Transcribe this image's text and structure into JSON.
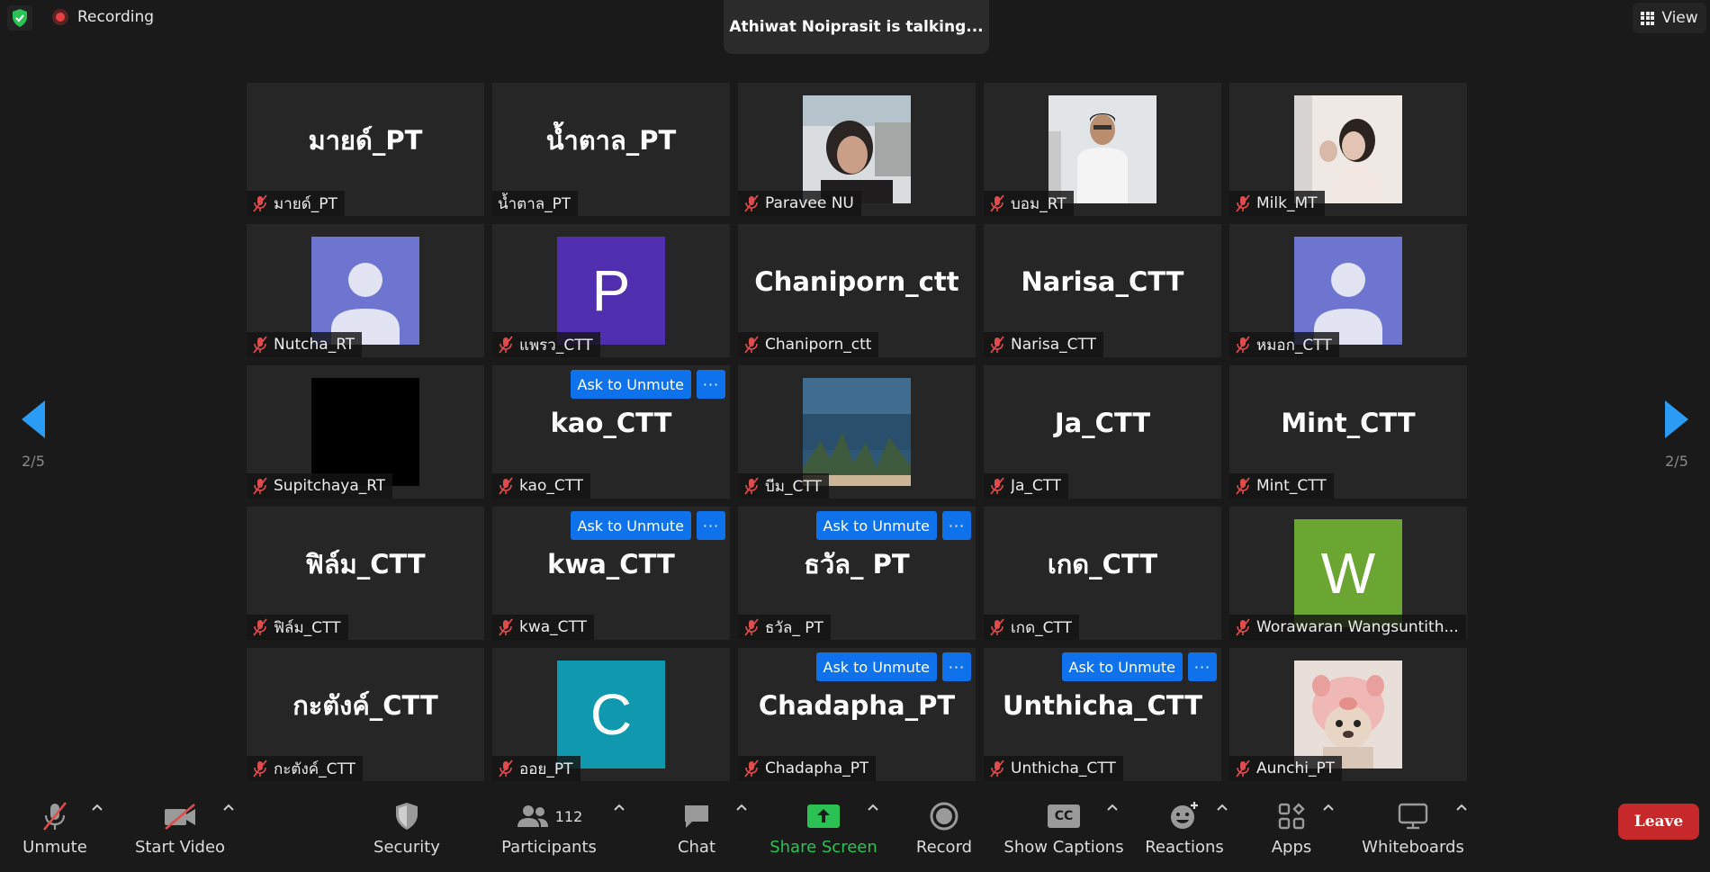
{
  "top": {
    "recording_label": "Recording",
    "talking_label": "Athiwat Noiprasit is talking...",
    "view_label": "View"
  },
  "pagination": {
    "left_label": "2/5",
    "right_label": "2/5"
  },
  "ask_label": "Ask to Unmute",
  "more_label": "···",
  "tiles": [
    {
      "name": "มายด์_PT",
      "big": "มายด์_PT",
      "muted": true
    },
    {
      "name": "น้ำตาล_PT",
      "big": "น้ำตาล_PT",
      "muted": false
    },
    {
      "name": "Paravee NU",
      "photo": "woman-selfie",
      "muted": true
    },
    {
      "name": "บอม_RT",
      "photo": "man-portrait",
      "muted": true
    },
    {
      "name": "Milk_MT",
      "photo": "woman-light",
      "muted": true
    },
    {
      "name": "Nutcha_RT",
      "avatar": "default",
      "muted": true
    },
    {
      "name": "แพรว_CTT",
      "letter": "P",
      "color": "#4f2faf",
      "muted": true
    },
    {
      "name": "Chaniporn_ctt",
      "big": "Chaniporn_ctt",
      "muted": true
    },
    {
      "name": "Narisa_CTT",
      "big": "Narisa_CTT",
      "muted": true
    },
    {
      "name": "หมอก_CTT",
      "avatar": "default",
      "muted": true
    },
    {
      "name": "Supitchaya_RT",
      "black": true,
      "muted": true
    },
    {
      "name": "kao_CTT",
      "big": "kao_CTT",
      "ask": true,
      "muted": true
    },
    {
      "name": "บีม_CTT",
      "photo": "sea",
      "muted": true
    },
    {
      "name": "Ja_CTT",
      "big": "Ja_CTT",
      "muted": true
    },
    {
      "name": "Mint_CTT",
      "big": "Mint_CTT",
      "muted": true
    },
    {
      "name": "ฟิล์ม_CTT",
      "big": "ฟิล์ม_CTT",
      "muted": true
    },
    {
      "name": "kwa_CTT",
      "big": "kwa_CTT",
      "ask": true,
      "muted": true
    },
    {
      "name": "ธวัล_ PT",
      "big": "ธวัล_ PT",
      "ask": true,
      "muted": true
    },
    {
      "name": "เกด_CTT",
      "big": "เกด_CTT",
      "muted": true
    },
    {
      "name": "Worawaran Wangsuntith...",
      "letter": "W",
      "color": "#6aa631",
      "muted": true
    },
    {
      "name": "กะตังค์_CTT",
      "big": "กะตังค์_CTT",
      "muted": true
    },
    {
      "name": "ออย_PT",
      "letter": "C",
      "color": "#0f98ae",
      "muted": true
    },
    {
      "name": "Chadapha_PT",
      "big": "Chadapha_PT",
      "ask": true,
      "muted": true
    },
    {
      "name": "Unthicha_CTT",
      "big": "Unthicha_CTT",
      "ask": true,
      "muted": true
    },
    {
      "name": "Aunchi_PT",
      "photo": "pig-toy",
      "muted": true
    }
  ],
  "toolbar": {
    "unmute": "Unmute",
    "start_video": "Start Video",
    "security": "Security",
    "participants": "Participants",
    "participants_count": "112",
    "chat": "Chat",
    "share_screen": "Share Screen",
    "record": "Record",
    "show_captions": "Show Captions",
    "captions_icon_text": "CC",
    "reactions": "Reactions",
    "apps": "Apps",
    "whiteboards": "Whiteboards",
    "leave": "Leave"
  },
  "colors": {
    "background": "#1a1a1a",
    "tile": "#262626",
    "accent_blue": "#0e72ed",
    "share_green": "#2bc254",
    "leave_red": "#c7282a",
    "mute_red": "#e04b4b"
  }
}
